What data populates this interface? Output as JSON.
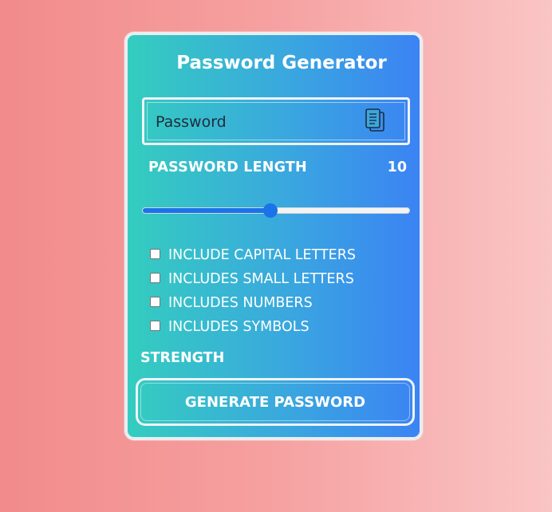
{
  "app": {
    "title": "Password Generator"
  },
  "password": {
    "placeholder": "Password",
    "value": "",
    "copy_icon": "copy-icon"
  },
  "length": {
    "label": "PASSWORD LENGTH",
    "value": "10",
    "slider_fraction": 0.48
  },
  "options": [
    {
      "label": "INCLUDE CAPITAL LETTERS",
      "checked": false
    },
    {
      "label": "INCLUDES SMALL LETTERS",
      "checked": false
    },
    {
      "label": "INCLUDES NUMBERS",
      "checked": false
    },
    {
      "label": "INCLUDES SYMBOLS",
      "checked": false
    }
  ],
  "strength": {
    "label": "STRENGTH"
  },
  "generate": {
    "label": "GENERATE PASSWORD"
  },
  "colors": {
    "background_left": "#f28b8b",
    "background_right": "#fac5c5",
    "card_left": "#34cdbf",
    "card_right": "#3b83f4",
    "slider_accent": "#1a73e8",
    "text": "#ffffff"
  }
}
